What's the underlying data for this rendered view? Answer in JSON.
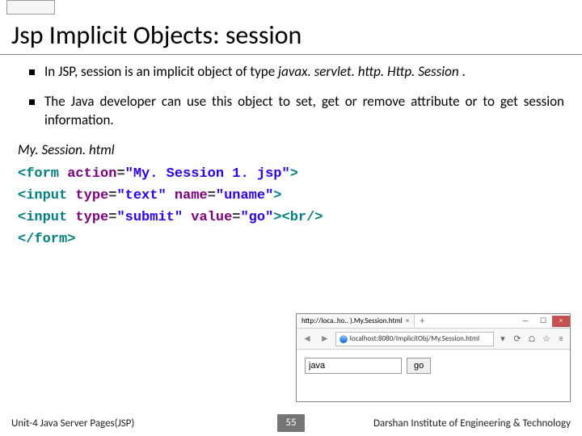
{
  "title": "Jsp Implicit Objects: session",
  "bullets": {
    "b1_pre": "In JSP, session is an implicit object of type ",
    "b1_code": "javax. servlet. http. Http. Session",
    "b1_post": " .",
    "b2": "The Java developer can use this object to set, get or remove attribute or to get session information."
  },
  "file_label": "My. Session. html",
  "code": {
    "l1a": "<form ",
    "l1b": "action",
    "l1c": "=",
    "l1d": "\"My. Session 1. jsp\"",
    "l1e": ">",
    "l2a": "<input ",
    "l2b": "type",
    "l2c": "=",
    "l2d": "\"text\"",
    "l2e": " name",
    "l2f": "=",
    "l2g": "\"uname\"",
    "l2h": ">",
    "l3a": "<input ",
    "l3b": "type",
    "l3c": "=",
    "l3d": "\"submit\"",
    "l3e": " value",
    "l3f": "=",
    "l3g": "\"go\"",
    "l3h": "><br/>",
    "l4": "</form>"
  },
  "browser": {
    "tab_title": "http://loca..ho.. ).My.Session.html",
    "url": "localhost:8080/ImplicitObj/My.Session.html",
    "input_value": "java",
    "button_label": "go"
  },
  "footer": {
    "left": "Unit-4 Java Server Pages(JSP)",
    "page": "55",
    "right": "Darshan Institute of Engineering & Technology"
  }
}
